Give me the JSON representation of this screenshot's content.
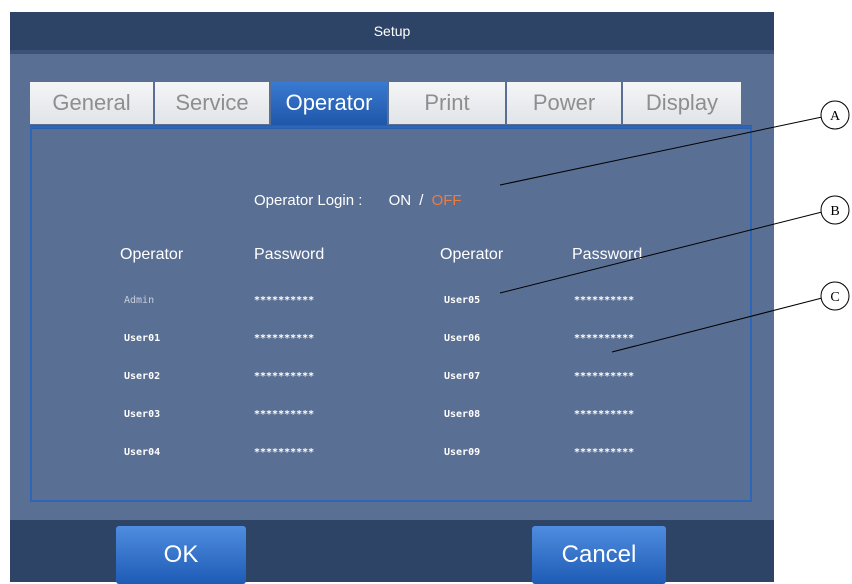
{
  "window": {
    "title": "Setup"
  },
  "tabs": [
    {
      "label": "General",
      "active": false
    },
    {
      "label": "Service",
      "active": false
    },
    {
      "label": "Operator",
      "active": true
    },
    {
      "label": "Print",
      "active": false
    },
    {
      "label": "Power",
      "active": false
    },
    {
      "label": "Display",
      "active": false
    }
  ],
  "login": {
    "label": "Operator Login :",
    "on": "ON",
    "sep": "/",
    "off": "OFF",
    "off_color": "#f07b3f"
  },
  "table": {
    "headers": {
      "operator": "Operator",
      "password": "Password"
    },
    "left": [
      {
        "user": "Admin",
        "password": "**********"
      },
      {
        "user": "User01",
        "password": "**********"
      },
      {
        "user": "User02",
        "password": "**********"
      },
      {
        "user": "User03",
        "password": "**********"
      },
      {
        "user": "User04",
        "password": "**********"
      }
    ],
    "right": [
      {
        "user": "User05",
        "password": "**********"
      },
      {
        "user": "User06",
        "password": "**********"
      },
      {
        "user": "User07",
        "password": "**********"
      },
      {
        "user": "User08",
        "password": "**********"
      },
      {
        "user": "User09",
        "password": "**********"
      }
    ]
  },
  "buttons": {
    "ok": "OK",
    "cancel": "Cancel"
  },
  "callouts": [
    "A",
    "B",
    "C"
  ],
  "colors": {
    "title_bar": "#2e4467",
    "panel": "#5a6f94",
    "accent": "#1e56a8"
  }
}
